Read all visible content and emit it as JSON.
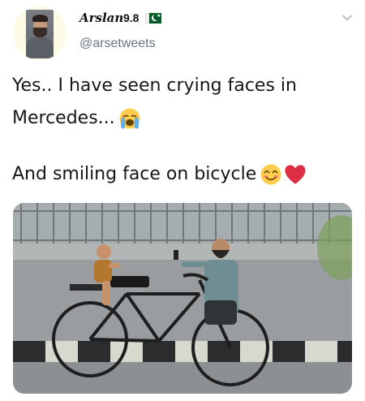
{
  "user": {
    "display_name": "Arslan",
    "name_suffix": "9.8",
    "handle": "@arsetweets"
  },
  "tweet": {
    "line1": "Yes.. I have seen crying faces in",
    "line2": "Mercedes...",
    "line3": "And smiling face on bicycle"
  },
  "icons": {
    "flag": "pakistan-flag-icon",
    "crying": "loudly-crying-face-emoji",
    "smile": "smiling-face-emoji",
    "heart": "red-heart-emoji",
    "menu": "chevron-down-icon"
  },
  "colors": {
    "text": "#14171a",
    "handle": "#657786",
    "chevron": "#aab8c2",
    "heart": "#dd2e44",
    "emoji_yellow": "#ffcc4d"
  }
}
